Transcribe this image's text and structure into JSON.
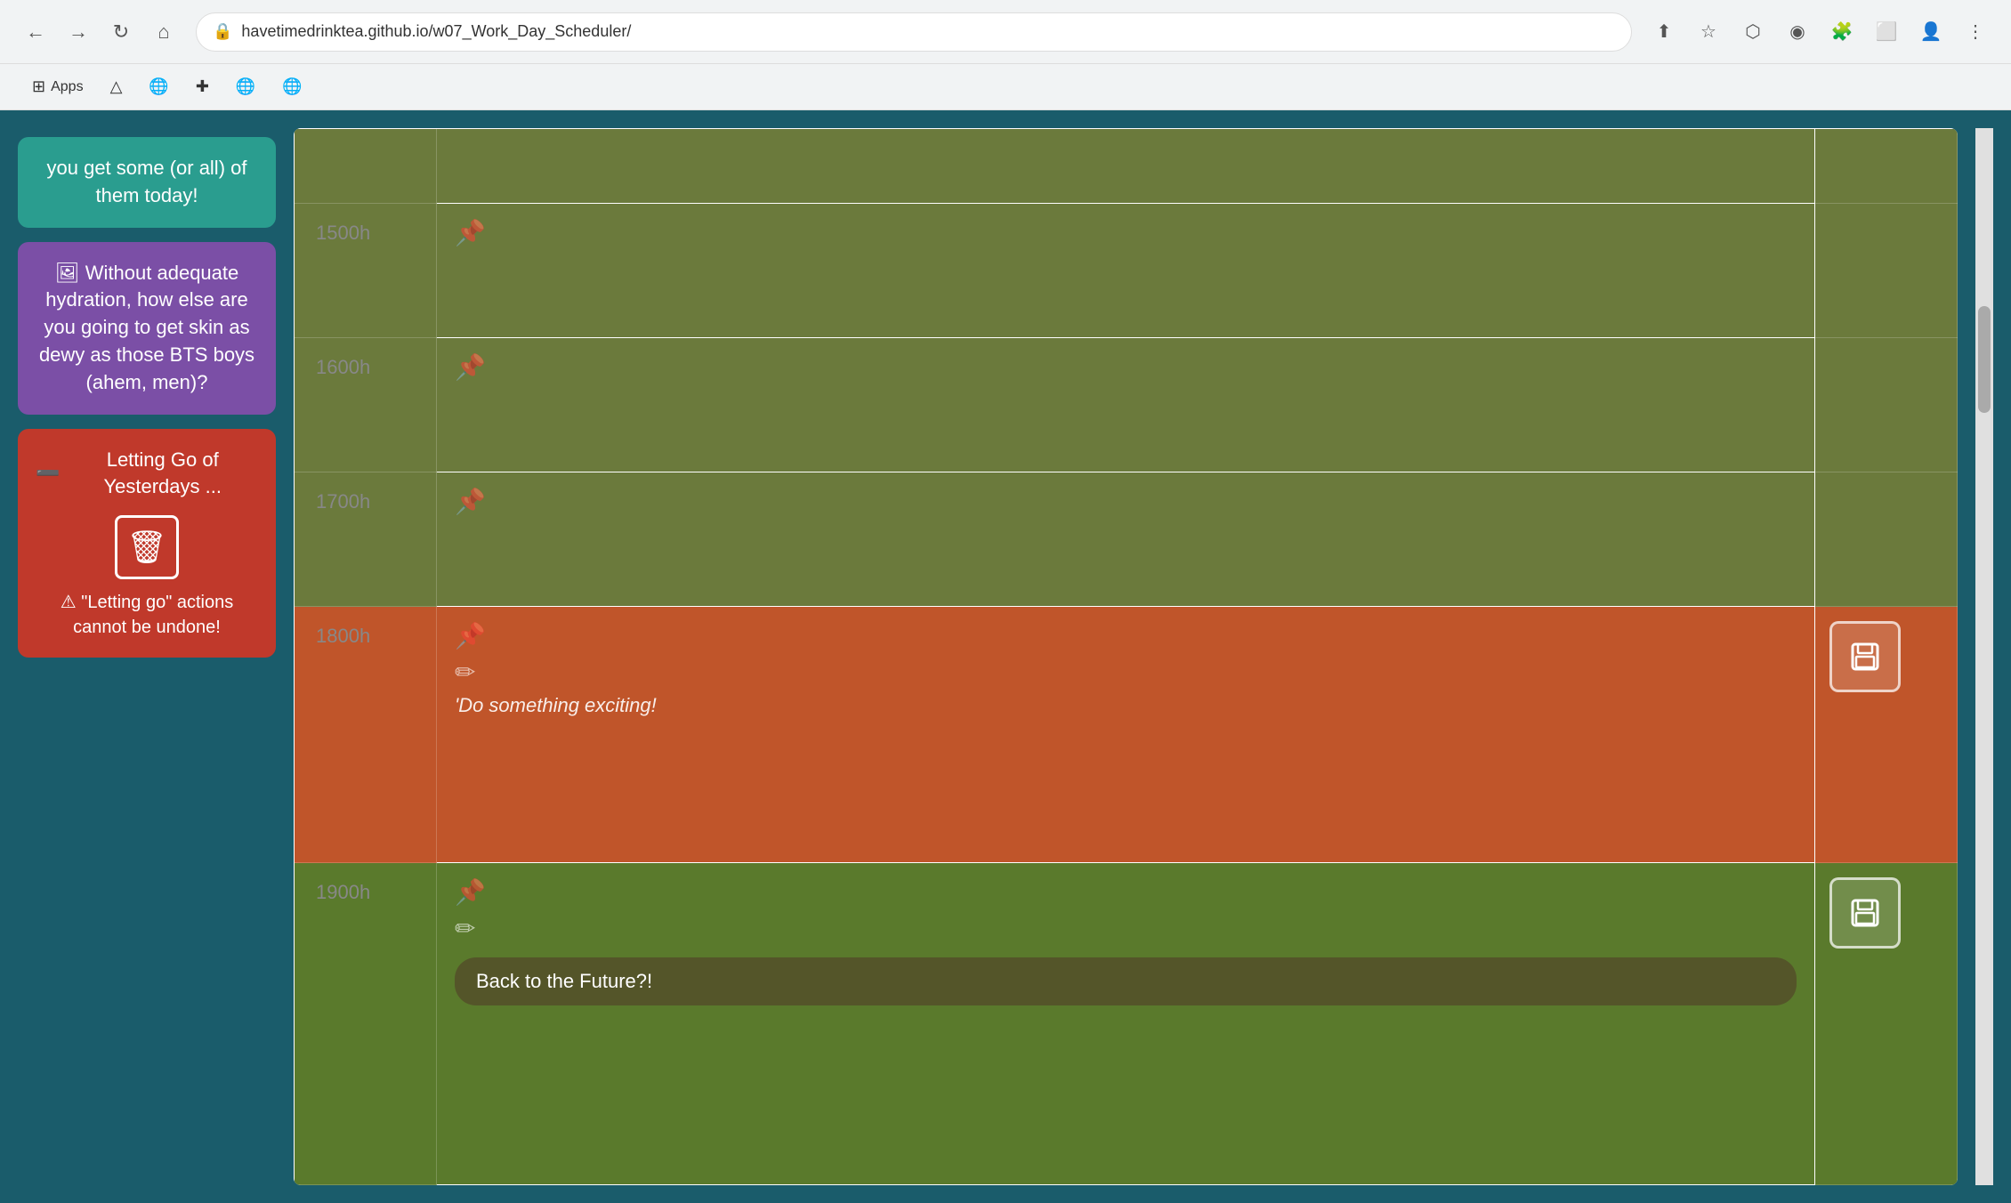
{
  "browser": {
    "url": "havetimedrinktea.github.io/w07_Work_Day_Scheduler/",
    "back_disabled": false,
    "forward_disabled": false
  },
  "bookmarks": {
    "apps_label": "Apps"
  },
  "sidebar": {
    "tip_card": {
      "text": "you get some (or all) of them today!"
    },
    "hydration_card": {
      "icon": "🖼",
      "text": "Without adequate hydration, how else are you going to get skin as dewy as those BTS boys (ahem, men)?"
    },
    "letting_go_card": {
      "title": "Letting Go of Yesterdays ...",
      "minus_icon": "➖",
      "trash_icon": "🗑",
      "warning_icon": "⚠",
      "warning_text": "\"Letting go\" actions cannot be undone!"
    }
  },
  "scheduler": {
    "rows": [
      {
        "time": "",
        "color": "olive",
        "has_pin": false,
        "has_edit": false,
        "task_text": "",
        "input_value": "",
        "has_save": false
      },
      {
        "time": "1500h",
        "color": "olive",
        "has_pin": true,
        "has_edit": false,
        "task_text": "",
        "input_value": "",
        "has_save": false
      },
      {
        "time": "1600h",
        "color": "olive",
        "has_pin": true,
        "has_edit": false,
        "task_text": "",
        "input_value": "",
        "has_save": false
      },
      {
        "time": "1700h",
        "color": "olive",
        "has_pin": true,
        "has_edit": false,
        "task_text": "",
        "input_value": "",
        "has_save": false
      },
      {
        "time": "1800h",
        "color": "orange",
        "has_pin": true,
        "has_edit": true,
        "task_text": "'Do something exciting!",
        "input_value": "",
        "has_save": true
      },
      {
        "time": "1900h",
        "color": "green",
        "has_pin": true,
        "has_edit": true,
        "task_text": "",
        "input_value": "Back to the Future?!",
        "has_save": true
      }
    ]
  }
}
